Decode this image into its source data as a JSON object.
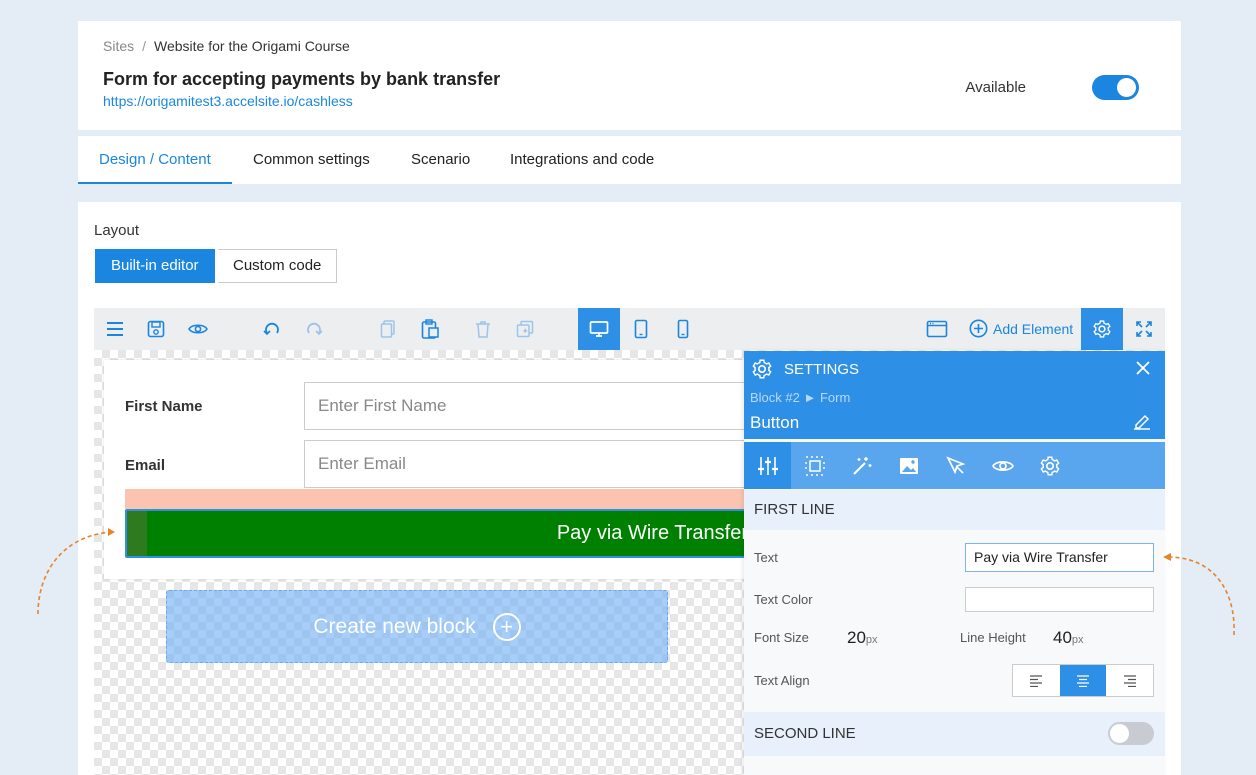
{
  "header": {
    "breadcrumb_root": "Sites",
    "breadcrumb_sep": "/",
    "breadcrumb_current": "Website for the Origami Course",
    "title": "Form for accepting payments by bank transfer",
    "url": "https://origamitest3.accelsite.io/cashless",
    "available_label": "Available",
    "available_on": true
  },
  "tabs": [
    {
      "label": "Design / Content",
      "active": true
    },
    {
      "label": "Common settings",
      "active": false
    },
    {
      "label": "Scenario",
      "active": false
    },
    {
      "label": "Integrations and code",
      "active": false
    }
  ],
  "layout": {
    "label": "Layout",
    "builtin_label": "Built-in editor",
    "custom_label": "Custom code"
  },
  "toolbar": {
    "add_element_label": "Add Element",
    "icons": [
      "menu-icon",
      "save-icon",
      "preview-eye-icon",
      "undo-icon",
      "redo-icon",
      "copy-icon",
      "paste-icon",
      "delete-icon",
      "duplicate-icon",
      "desktop-icon",
      "tablet-icon",
      "mobile-icon",
      "window-icon",
      "add-circle-icon",
      "settings-gear-icon",
      "fullscreen-icon"
    ],
    "accent": "#1a86e0"
  },
  "form": {
    "first_name_label": "First Name",
    "first_name_placeholder": "Enter First Name",
    "email_label": "Email",
    "email_placeholder": "Enter Email",
    "button_text": "Pay via Wire Transfer",
    "button_color": "#008000",
    "create_block_label": "Create new block"
  },
  "settings": {
    "title": "SETTINGS",
    "crumb": "Block #2 ► Form",
    "element": "Button",
    "first_line_title": "FIRST LINE",
    "text_label": "Text",
    "text_value": "Pay via Wire Transfer",
    "text_color_label": "Text Color",
    "font_size_label": "Font Size",
    "font_size_value": "20",
    "line_height_label": "Line Height",
    "line_height_value": "40",
    "unit": "px",
    "text_align_label": "Text Align",
    "text_align_value": "center",
    "second_line_title": "SECOND LINE",
    "second_line_on": false,
    "tab_icons": [
      "sliders-icon",
      "spacing-grid-icon",
      "magic-wand-icon",
      "image-icon",
      "cursor-icon",
      "eye-icon",
      "gear-icon"
    ]
  }
}
